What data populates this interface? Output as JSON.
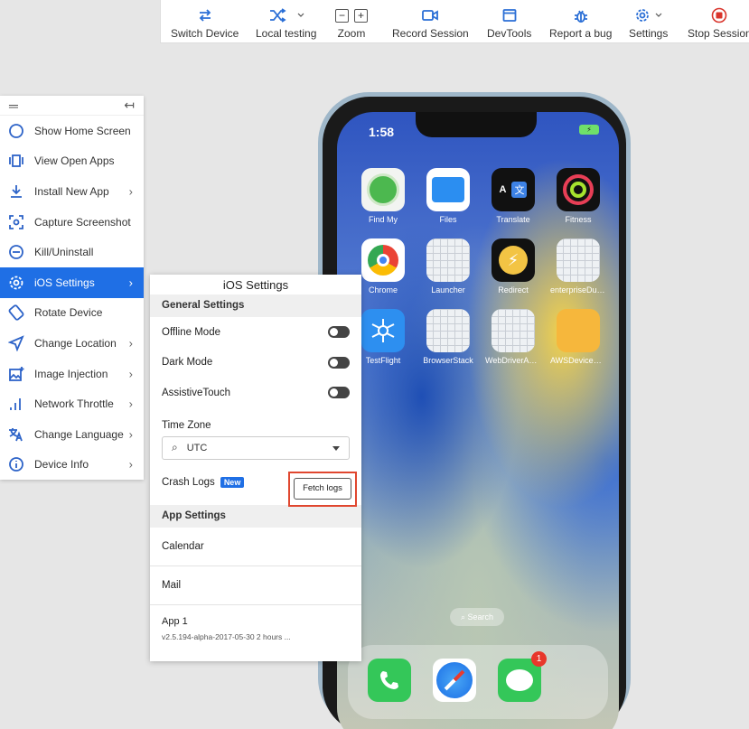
{
  "toolbar": {
    "switch_device": "Switch Device",
    "local_testing": "Local testing",
    "zoom": "Zoom",
    "zoom_out": "−",
    "zoom_in": "+",
    "record_session": "Record Session",
    "devtools": "DevTools",
    "report_bug": "Report a bug",
    "settings": "Settings",
    "stop_session": "Stop Session"
  },
  "leftmenu": {
    "collapse_glyph": "↤",
    "items": [
      {
        "label": "Show Home Screen",
        "icon": "circle-icon"
      },
      {
        "label": "View Open Apps",
        "icon": "apps-icon"
      },
      {
        "label": "Install New App",
        "icon": "download-icon"
      },
      {
        "label": "Capture Screenshot",
        "icon": "camera-icon"
      },
      {
        "label": "Kill/Uninstall",
        "icon": "minus-circle-icon"
      },
      {
        "label": "iOS Settings",
        "icon": "gear-icon"
      },
      {
        "label": "Rotate Device",
        "icon": "rotate-icon"
      },
      {
        "label": "Change Location",
        "icon": "location-icon"
      },
      {
        "label": "Image Injection",
        "icon": "image-icon"
      },
      {
        "label": "Network Throttle",
        "icon": "signal-icon"
      },
      {
        "label": "Change Language",
        "icon": "translate-icon"
      },
      {
        "label": "Device Info",
        "icon": "info-icon"
      }
    ]
  },
  "ios_settings": {
    "title": "iOS Settings",
    "general_header": "General Settings",
    "offline_mode": "Offline Mode",
    "dark_mode": "Dark Mode",
    "assistive_touch": "AssistiveTouch",
    "time_zone_label": "Time Zone",
    "time_zone_value": "UTC",
    "crash_logs": "Crash Logs",
    "new_badge": "New",
    "fetch_logs": "Fetch logs",
    "app_settings_header": "App Settings",
    "apps": [
      "Calendar",
      "Mail"
    ],
    "app1_name": "App 1",
    "app1_sub": "v2.5.194-alpha-2017-05-30 2 hours ..."
  },
  "phone": {
    "time": "1:58",
    "battery": "⚡",
    "apps": [
      "Find My",
      "Files",
      "Translate",
      "Fitness",
      "Chrome",
      "Launcher",
      "Redirect",
      "enterpriseDum...",
      "TestFlight",
      "BrowserStack",
      "WebDriverAge...",
      "AWSDeviceFar..."
    ],
    "search": "Search",
    "messages_badge": "1"
  }
}
